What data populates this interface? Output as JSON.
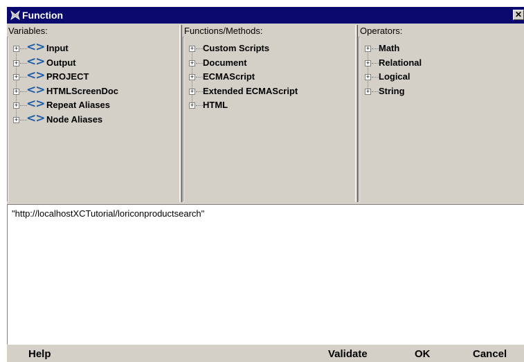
{
  "window": {
    "title": "Function",
    "close_label": "✕"
  },
  "panels": {
    "variables": {
      "header": "Variables:",
      "items": [
        {
          "label": "Input"
        },
        {
          "label": "Output"
        },
        {
          "label": "PROJECT"
        },
        {
          "label": "HTMLScreenDoc"
        },
        {
          "label": "Repeat Aliases"
        },
        {
          "label": "Node Aliases"
        }
      ]
    },
    "functions": {
      "header": "Functions/Methods:",
      "items": [
        {
          "label": "Custom Scripts"
        },
        {
          "label": "Document"
        },
        {
          "label": "ECMAScript"
        },
        {
          "label": "Extended ECMAScript"
        },
        {
          "label": "HTML"
        }
      ]
    },
    "operators": {
      "header": "Operators:",
      "items": [
        {
          "label": "Math"
        },
        {
          "label": "Relational"
        },
        {
          "label": "Logical"
        },
        {
          "label": "String"
        }
      ]
    }
  },
  "editor": {
    "value": "\"http://localhostXCTutorial/loriconproductsearch\""
  },
  "buttons": {
    "help": "Help",
    "validate": "Validate",
    "ok": "OK",
    "cancel": "Cancel"
  },
  "icons": {
    "expander": "+",
    "variable": "<>"
  },
  "colors": {
    "titlebar": "#0a0a6e",
    "variable_icon": "#1e5ea8",
    "dialog_bg": "#d4d0c8"
  }
}
